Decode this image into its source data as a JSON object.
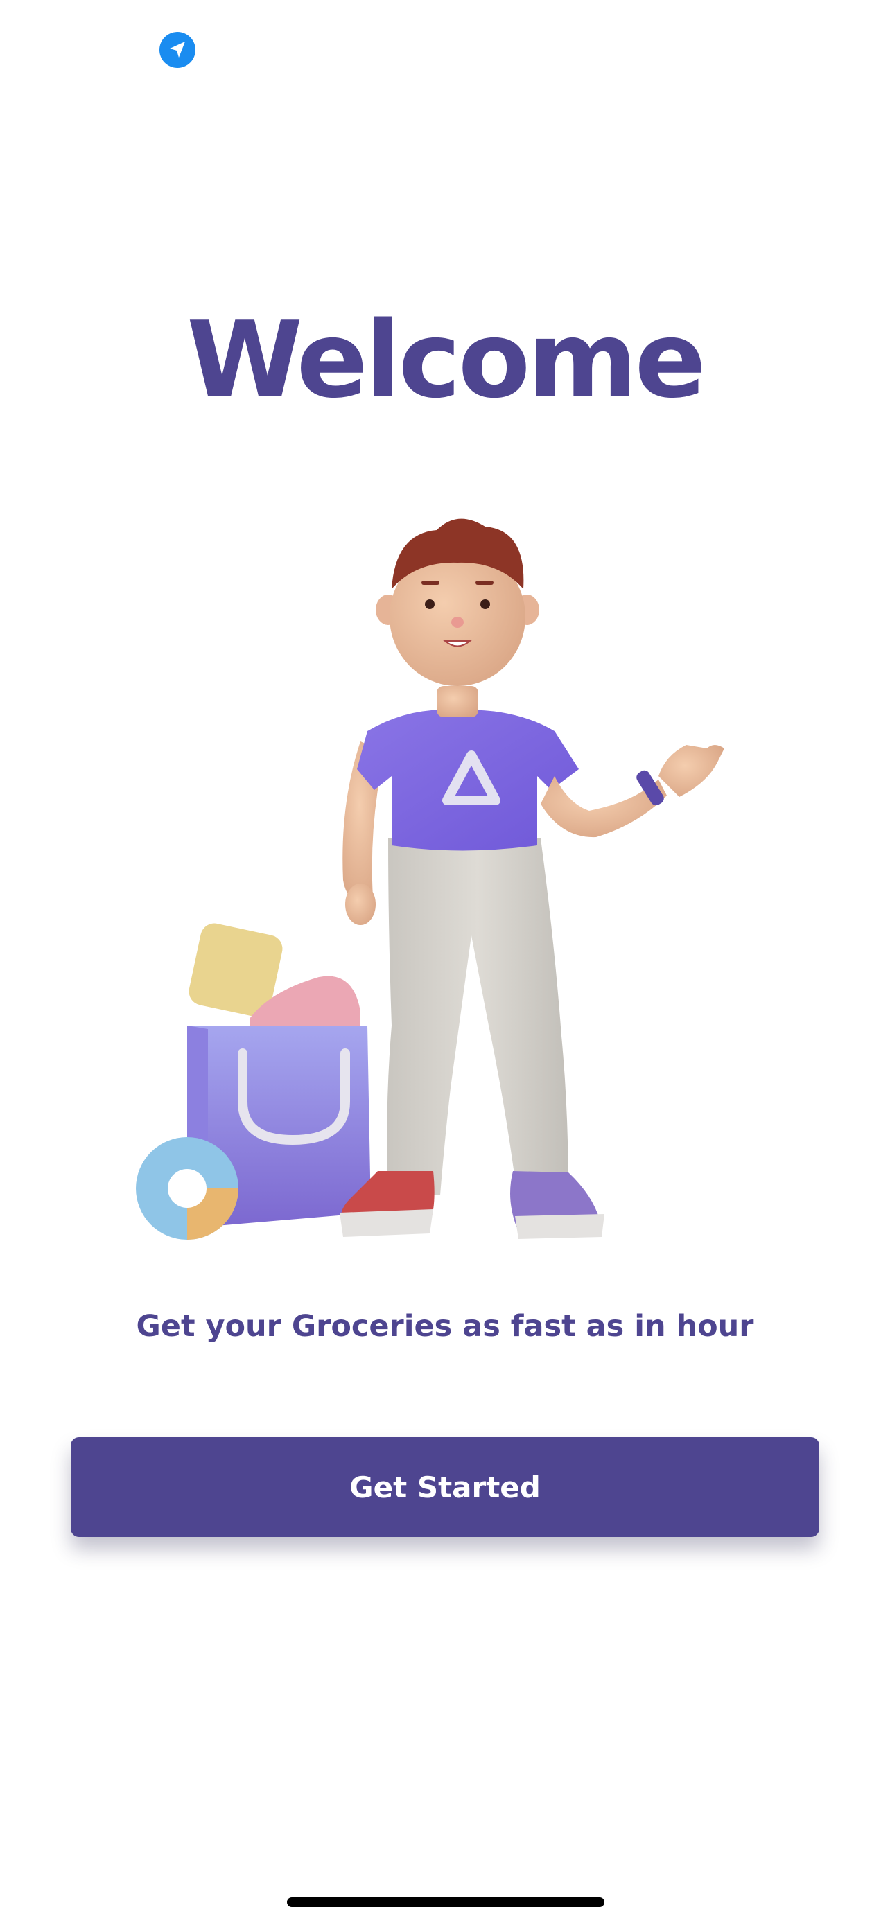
{
  "status_bar": {
    "location_icon": "location-arrow-icon"
  },
  "welcome": {
    "title": "Welcome",
    "illustration": "shopper-character-illustration",
    "tagline": "Get your Groceries as fast as in hour"
  },
  "actions": {
    "get_started_label": "Get Started"
  },
  "colors": {
    "brand": "#4e4590",
    "location_icon": "#1a8cf0",
    "background": "#ffffff"
  }
}
